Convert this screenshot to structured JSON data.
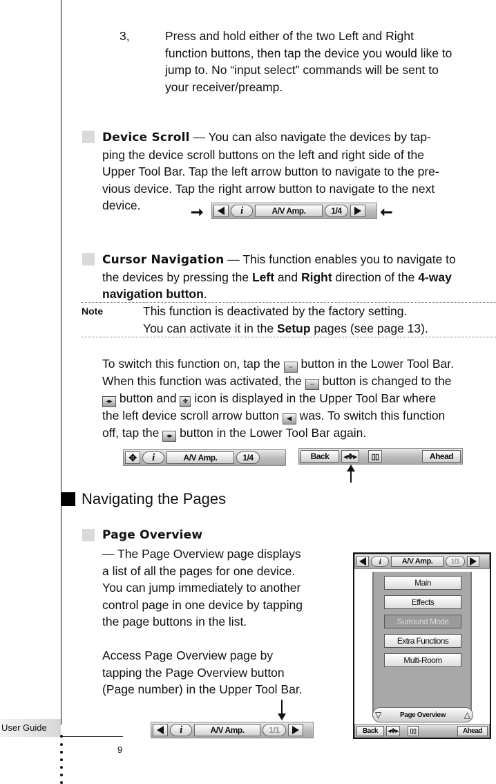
{
  "page": {
    "footer_label": "User Guide",
    "page_number": "9"
  },
  "step3": {
    "number": "3,",
    "lines": [
      "Press and hold either of the two Left and Right",
      "function  buttons, then tap the device you would like to",
      "jump to. No “input select” commands will be sent to",
      "your receiver/preamp."
    ]
  },
  "device_scroll": {
    "heading": "Device Scroll",
    "line1_rest": " — You can also navigate the devices by tap-",
    "lines": [
      "ping the device scroll buttons on the left and right side of the",
      "Upper Tool Bar. Tap the left arrow button to navigate to the pre-",
      "vious device. Tap the right arrow button to navigate to the next",
      "device."
    ]
  },
  "cursor_nav": {
    "heading": "Cursor Navigation",
    "line1_rest": " — This function enables you to navigate to",
    "line2_a": "the devices by pressing the ",
    "line2_left": "Left",
    "line2_and": " and ",
    "line2_right": "Right",
    "line2_b": " direction of the ",
    "line2_4way": "4-way",
    "line3_bold": "navigation button",
    "line3_end": ".",
    "note_label": "Note",
    "note_line1": "This function is deactivated by the factory setting.",
    "note_line2_a": "You can activate it in the ",
    "note_line2_bold": "Setup",
    "note_line2_b": " pages (see page 13).",
    "switch_para": {
      "l1a": "To switch this function on, tap the ",
      "l1b": " button in the Lower Tool Bar.",
      "l2a": "When this function was activated, the ",
      "l2b": " button is changed to the",
      "l3a": " button and ",
      "l3b": " icon is displayed in the Upper Tool Bar where",
      "l4a": "the left device scroll arrow button ",
      "l4b": " was. To switch this function",
      "l5a": "off, tap the ",
      "l5b": " button in the Lower Tool Bar again."
    }
  },
  "toolbars": {
    "device_name": "A/V Amp.",
    "page_indicator": "1/4",
    "page_indicator_single": "1/1",
    "info_glyph": "i",
    "back_label": "Back",
    "ahead_label": "Ahead"
  },
  "navigating": {
    "title": "Navigating the Pages"
  },
  "page_overview": {
    "heading": "Page Overview",
    "para1": [
      "— The Page Overview page displays",
      "a list of all the pages for one device.",
      "You can jump immediately to another",
      "control page in one device by tapping",
      "the page buttons in the list."
    ],
    "para2": [
      "Access Page Overview page by",
      "tapping the Page Overview button",
      "(Page number) in the Upper Tool Bar."
    ],
    "screen": {
      "pages": [
        {
          "label": "Main",
          "dimmed": false
        },
        {
          "label": "Effects",
          "dimmed": false
        },
        {
          "label": "Surround Mode",
          "dimmed": true
        },
        {
          "label": "Extra Functions",
          "dimmed": false
        },
        {
          "label": "Multi-Room",
          "dimmed": false
        }
      ],
      "overview_label": "Page Overview"
    }
  }
}
